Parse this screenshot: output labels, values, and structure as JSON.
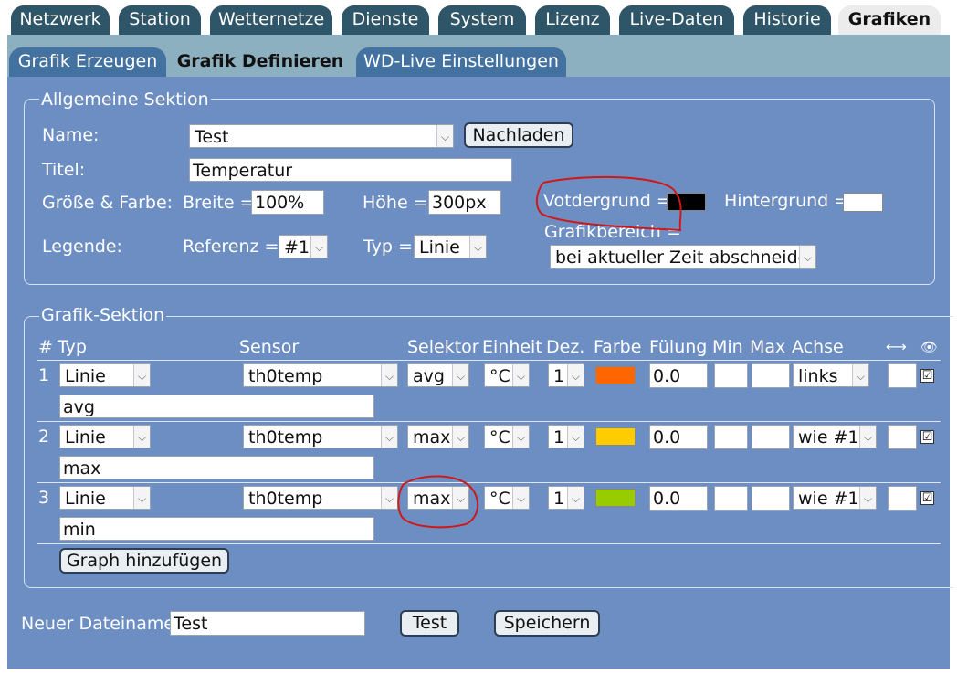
{
  "tabs_main": [
    {
      "label": "Netzwerk"
    },
    {
      "label": "Station"
    },
    {
      "label": "Wetternetze"
    },
    {
      "label": "Dienste"
    },
    {
      "label": "System"
    },
    {
      "label": "Lizenz"
    },
    {
      "label": "Live-Daten"
    },
    {
      "label": "Historie"
    },
    {
      "label": "Grafiken"
    }
  ],
  "tabs_sub": [
    {
      "label": "Grafik Erzeugen"
    },
    {
      "label": "Grafik Definieren"
    },
    {
      "label": "WD-Live Einstellungen"
    }
  ],
  "general": {
    "legend": "Allgemeine Sektion",
    "name_label": "Name:",
    "name_value": "Test",
    "reload_button": "Nachladen",
    "title_label": "Titel:",
    "title_value": "Temperatur",
    "size_label": "Größe & Farbe:",
    "width_label": "Breite =",
    "width_value": "100%",
    "height_label": "Höhe =",
    "height_value": "300px",
    "foreground_label": "Votdergrund =",
    "foreground_color": "#000000",
    "background_label": "Hintergrund =",
    "background_color": "#ffffff",
    "legend_label": "Legende:",
    "reference_label": "Referenz =",
    "reference_value": "#1",
    "type_label": "Typ =",
    "type_value": "Linie",
    "area_label": "Grafikbereich =",
    "area_value": "bei aktueller Zeit abschneiden"
  },
  "graph": {
    "legend": "Grafik-Sektion",
    "headers": {
      "num": "#",
      "type": "Typ",
      "sensor": "Sensor",
      "selector": "Selektor",
      "unit": "Einheit",
      "decimals": "Dez.",
      "color": "Farbe",
      "fill": "Fülung",
      "min": "Min",
      "max": "Max",
      "axis": "Achse",
      "range_icon": "⟷",
      "eye_icon": "👁"
    },
    "rows": [
      {
        "num": "1",
        "type": "Linie",
        "sensor": "th0temp",
        "selector": "avg",
        "unit": "°C",
        "decimals": "1",
        "color": "#ff6600",
        "fill": "0.0",
        "min": "",
        "max": "",
        "axis": "links",
        "range": "",
        "checked": "☑",
        "label": "avg"
      },
      {
        "num": "2",
        "type": "Linie",
        "sensor": "th0temp",
        "selector": "max",
        "unit": "°C",
        "decimals": "1",
        "color": "#ffcc00",
        "fill": "0.0",
        "min": "",
        "max": "",
        "axis": "wie #1",
        "range": "",
        "checked": "☑",
        "label": "max"
      },
      {
        "num": "3",
        "type": "Linie",
        "sensor": "th0temp",
        "selector": "max",
        "unit": "°C",
        "decimals": "1",
        "color": "#99cc00",
        "fill": "0.0",
        "min": "",
        "max": "",
        "axis": "wie #1",
        "range": "",
        "checked": "☑",
        "label": "min"
      }
    ],
    "add_button": "Graph hinzufügen"
  },
  "footer": {
    "filename_label": "Neuer Dateiname",
    "filename_value": "Test",
    "test_button": "Test",
    "save_button": "Speichern"
  }
}
